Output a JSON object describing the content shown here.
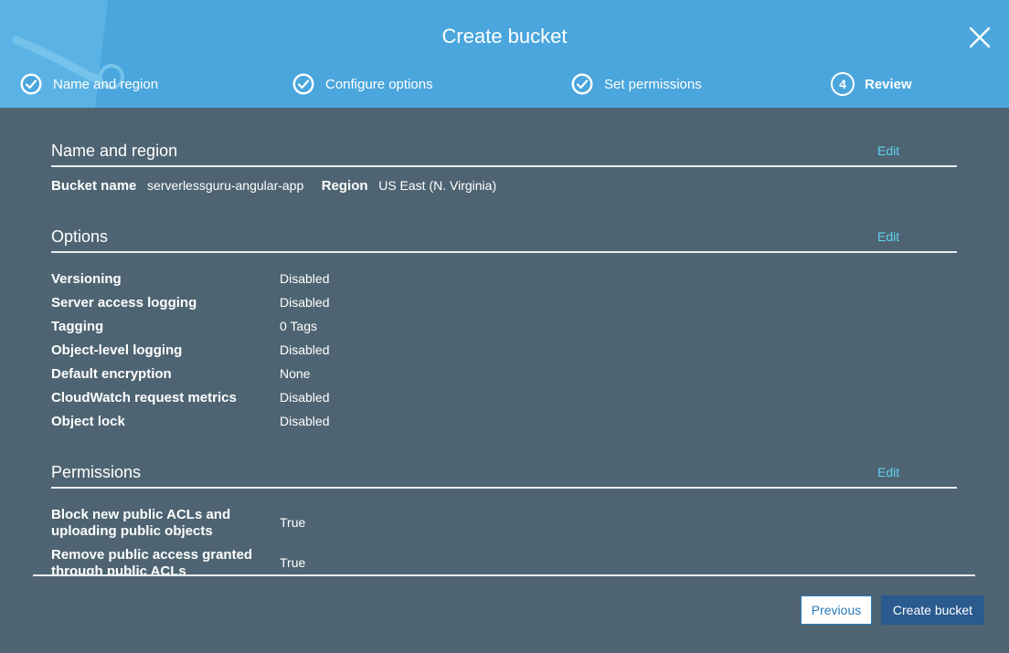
{
  "dialog": {
    "title": "Create bucket"
  },
  "steps": [
    {
      "label": "Name and region",
      "state": "done"
    },
    {
      "label": "Configure options",
      "state": "done"
    },
    {
      "label": "Set permissions",
      "state": "done"
    },
    {
      "label": "Review",
      "state": "active",
      "number": "4"
    }
  ],
  "name_region": {
    "title": "Name and region",
    "edit_label": "Edit",
    "bucket_name_label": "Bucket name",
    "bucket_name_value": "serverlessguru-angular-app",
    "region_label": "Region",
    "region_value": "US East (N. Virginia)"
  },
  "options": {
    "title": "Options",
    "edit_label": "Edit",
    "rows": [
      {
        "key": "Versioning",
        "value": "Disabled"
      },
      {
        "key": "Server access logging",
        "value": "Disabled"
      },
      {
        "key": "Tagging",
        "value": "0 Tags"
      },
      {
        "key": "Object-level logging",
        "value": "Disabled"
      },
      {
        "key": "Default encryption",
        "value": "None"
      },
      {
        "key": "CloudWatch request metrics",
        "value": "Disabled"
      },
      {
        "key": "Object lock",
        "value": "Disabled"
      }
    ]
  },
  "permissions": {
    "title": "Permissions",
    "edit_label": "Edit",
    "rows": [
      {
        "key_line1": "Block new public ACLs and",
        "key_line2": "uploading public objects",
        "value": "True"
      },
      {
        "key_line1": "Remove public access granted",
        "key_line2": "through public ACLs",
        "value": "True"
      }
    ]
  },
  "footer": {
    "previous_label": "Previous",
    "create_label": "Create bucket"
  },
  "colors": {
    "header": "#4aa6dd",
    "body": "#4e6472",
    "edit_link": "#5fd2f0",
    "primary_button": "#2a5a8e"
  }
}
